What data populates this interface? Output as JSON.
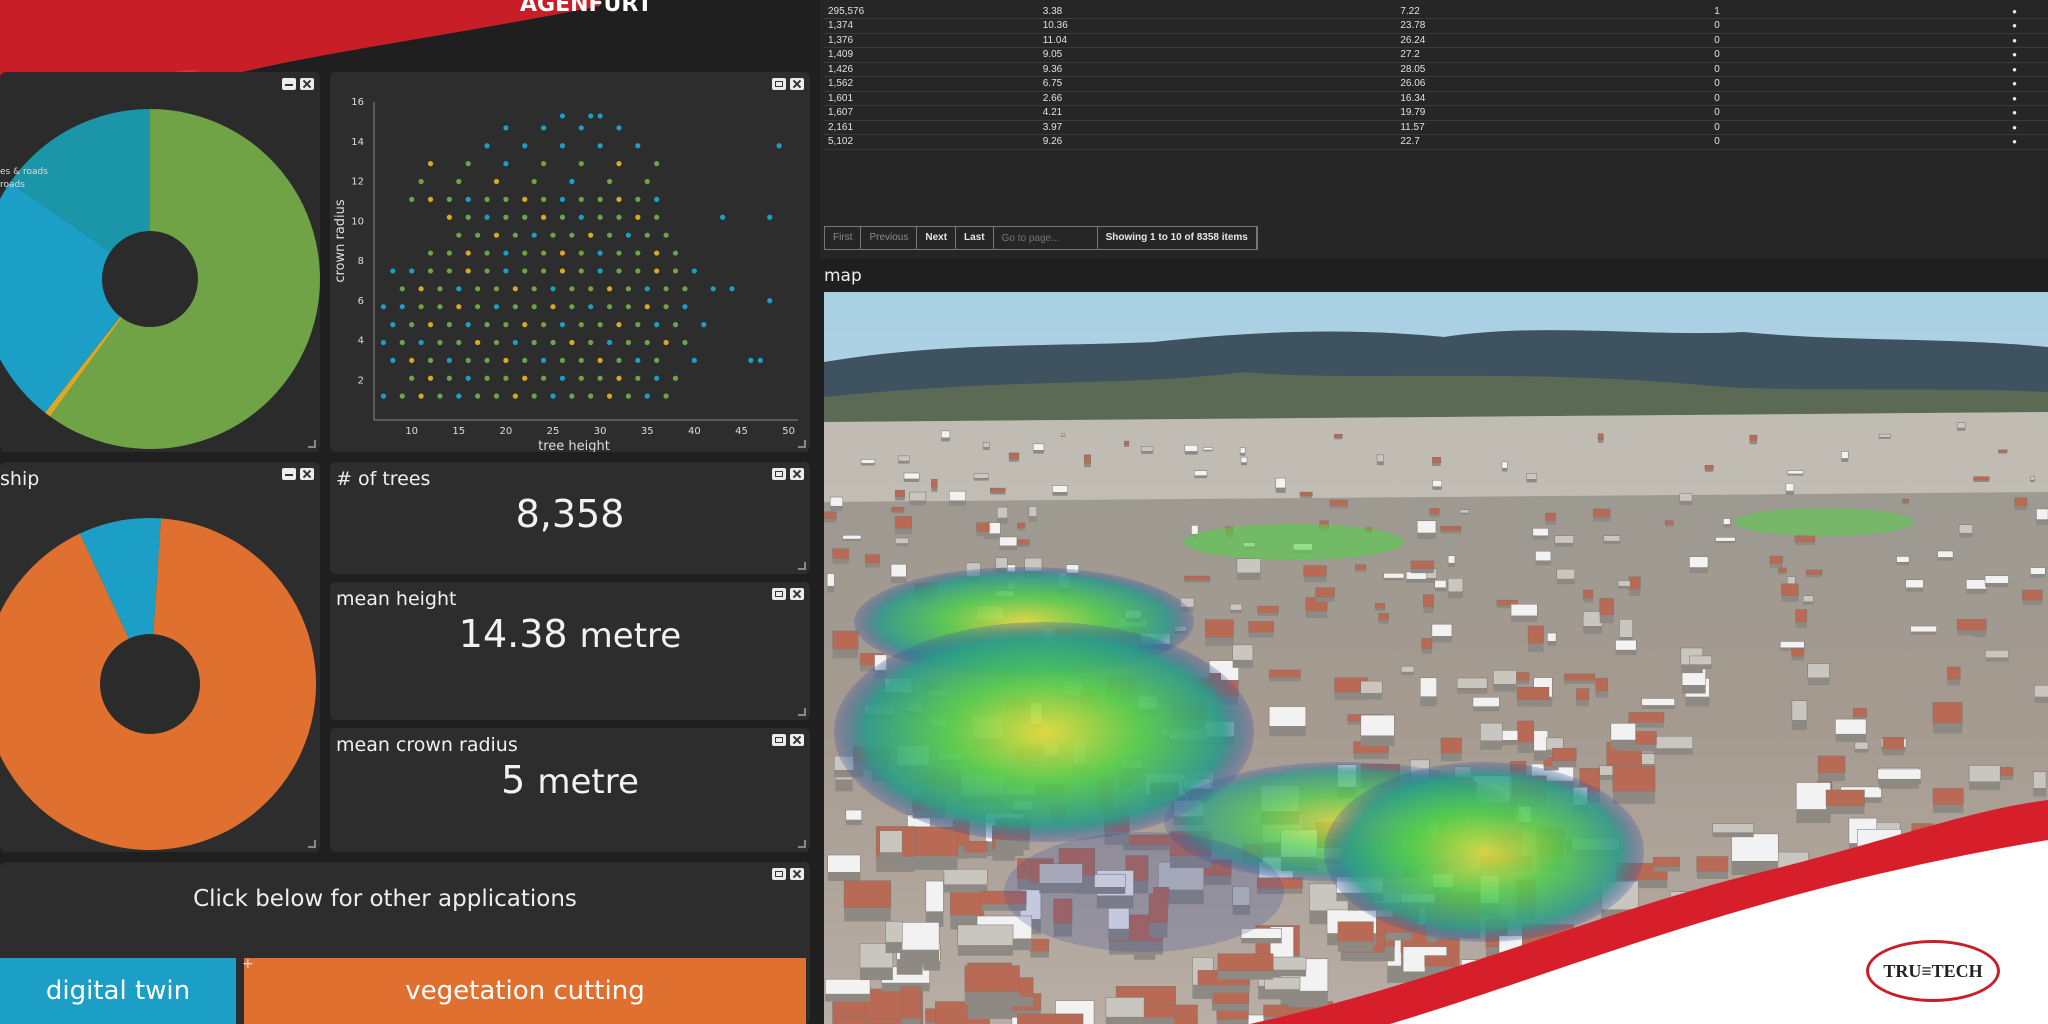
{
  "header": {
    "title": "AGENFURT"
  },
  "colors": {
    "bg": "#1f1f1f",
    "panel": "#2d2d2d",
    "green": "#6fa346",
    "blue": "#1b9fc6",
    "teal": "#1b95a8",
    "orange": "#e07030",
    "yellow": "#d9a826",
    "red": "#d61f2b"
  },
  "scatter": {
    "ylabel": "crown radius",
    "xlabel": "tree height",
    "xticks": [
      "10",
      "15",
      "20",
      "25",
      "30",
      "35",
      "40",
      "45",
      "50"
    ],
    "yticks": [
      "2",
      "4",
      "6",
      "8",
      "10",
      "12",
      "14",
      "16"
    ]
  },
  "pie_top": {
    "legend": [
      "es & roads",
      "roads"
    ]
  },
  "ownership": {
    "title": "ship"
  },
  "trees": {
    "title": "# of trees",
    "value": "8,358"
  },
  "mean_height": {
    "title": "mean height",
    "value": "14.38",
    "unit": "metre"
  },
  "mean_crown": {
    "title": "mean crown radius",
    "value": "5",
    "unit": "metre"
  },
  "apps": {
    "prompt": "Click below for other applications",
    "digital_twin": "digital twin",
    "vegetation": "vegetation cutting"
  },
  "table": {
    "rows": [
      [
        "295,576",
        "3.38",
        "7.22",
        "1"
      ],
      [
        "1,374",
        "10.36",
        "23.78",
        "0"
      ],
      [
        "1,376",
        "11.04",
        "26.24",
        "0"
      ],
      [
        "1,409",
        "9.05",
        "27.2",
        "0"
      ],
      [
        "1,426",
        "9.36",
        "28.05",
        "0"
      ],
      [
        "1,562",
        "6.75",
        "26.06",
        "0"
      ],
      [
        "1,601",
        "2.66",
        "16.34",
        "0"
      ],
      [
        "1,607",
        "4.21",
        "19.79",
        "0"
      ],
      [
        "2,161",
        "3.97",
        "11.57",
        "0"
      ],
      [
        "5,102",
        "9.26",
        "22.7",
        "0"
      ]
    ]
  },
  "pager": {
    "first": "First",
    "previous": "Previous",
    "next": "Next",
    "last": "Last",
    "goto_placeholder": "Go to page...",
    "status": "Showing 1 to 10 of 8358 items"
  },
  "map": {
    "title": "map"
  },
  "logo": {
    "text": "TRU≡TECH"
  },
  "chart_data": [
    {
      "type": "pie",
      "title": "",
      "legend": [
        "es & roads",
        "roads"
      ],
      "slices": [
        {
          "label": "green",
          "value": 60,
          "color": "#6fa346"
        },
        {
          "label": "thin",
          "value": 0.6,
          "color": "#d9a826"
        },
        {
          "label": "blue",
          "value": 24,
          "color": "#1b9fc6"
        },
        {
          "label": "teal",
          "value": 15.4,
          "color": "#1b95a8"
        }
      ]
    },
    {
      "type": "pie",
      "title": "ship",
      "slices": [
        {
          "label": "blue",
          "value": 8,
          "color": "#1b9fc6"
        },
        {
          "label": "orange",
          "value": 92,
          "color": "#e07030"
        }
      ]
    },
    {
      "type": "scatter",
      "xlabel": "tree height",
      "ylabel": "crown radius",
      "xlim": [
        6,
        51
      ],
      "ylim": [
        0,
        16
      ],
      "grid": false,
      "x": [
        7,
        9,
        11,
        13,
        15,
        17,
        19,
        21,
        23,
        25,
        27,
        29,
        31,
        33,
        35,
        37,
        10,
        12,
        14,
        16,
        18,
        20,
        22,
        24,
        26,
        28,
        30,
        32,
        34,
        36,
        38,
        8,
        10,
        12,
        14,
        16,
        18,
        20,
        22,
        24,
        26,
        28,
        30,
        32,
        34,
        36,
        40,
        7,
        9,
        11,
        13,
        15,
        17,
        19,
        21,
        23,
        25,
        27,
        29,
        31,
        33,
        35,
        37,
        39,
        46,
        8,
        10,
        12,
        14,
        16,
        18,
        20,
        22,
        24,
        26,
        28,
        30,
        32,
        34,
        36,
        38,
        41,
        47,
        7,
        9,
        11,
        13,
        15,
        17,
        19,
        21,
        23,
        25,
        27,
        29,
        31,
        33,
        35,
        37,
        39,
        48,
        9,
        11,
        13,
        15,
        17,
        19,
        21,
        23,
        25,
        27,
        29,
        31,
        33,
        35,
        37,
        39,
        42,
        8,
        10,
        12,
        14,
        16,
        18,
        20,
        22,
        24,
        26,
        28,
        30,
        32,
        34,
        36,
        38,
        40,
        12,
        14,
        16,
        18,
        20,
        22,
        24,
        26,
        28,
        30,
        32,
        34,
        36,
        38,
        44,
        15,
        17,
        19,
        21,
        23,
        25,
        27,
        29,
        31,
        33,
        35,
        37,
        14,
        16,
        18,
        20,
        22,
        24,
        26,
        28,
        30,
        32,
        34,
        36,
        43,
        48,
        10,
        12,
        14,
        16,
        18,
        20,
        22,
        24,
        26,
        28,
        30,
        32,
        34,
        36,
        11,
        15,
        19,
        23,
        27,
        31,
        35,
        12,
        16,
        20,
        24,
        28,
        32,
        36,
        18,
        22,
        26,
        30,
        34,
        49,
        20,
        24,
        28,
        32,
        29,
        30,
        26
      ],
      "y": [
        1.2,
        1.2,
        1.2,
        1.2,
        1.2,
        1.2,
        1.2,
        1.2,
        1.2,
        1.2,
        1.2,
        1.2,
        1.2,
        1.2,
        1.2,
        1.2,
        2.1,
        2.1,
        2.1,
        2.1,
        2.1,
        2.1,
        2.1,
        2.1,
        2.1,
        2.1,
        2.1,
        2.1,
        2.1,
        2.1,
        2.1,
        3.0,
        3.0,
        3.0,
        3.0,
        3.0,
        3.0,
        3.0,
        3.0,
        3.0,
        3.0,
        3.0,
        3.0,
        3.0,
        3.0,
        3.0,
        3.0,
        3.9,
        3.9,
        3.9,
        3.9,
        3.9,
        3.9,
        3.9,
        3.9,
        3.9,
        3.9,
        3.9,
        3.9,
        3.9,
        3.9,
        3.9,
        3.9,
        3.9,
        3.0,
        4.8,
        4.8,
        4.8,
        4.8,
        4.8,
        4.8,
        4.8,
        4.8,
        4.8,
        4.8,
        4.8,
        4.8,
        4.8,
        4.8,
        4.8,
        4.8,
        4.8,
        3.0,
        5.7,
        5.7,
        5.7,
        5.7,
        5.7,
        5.7,
        5.7,
        5.7,
        5.7,
        5.7,
        5.7,
        5.7,
        5.7,
        5.7,
        5.7,
        5.7,
        5.7,
        6.0,
        6.6,
        6.6,
        6.6,
        6.6,
        6.6,
        6.6,
        6.6,
        6.6,
        6.6,
        6.6,
        6.6,
        6.6,
        6.6,
        6.6,
        6.6,
        6.6,
        6.6,
        7.5,
        7.5,
        7.5,
        7.5,
        7.5,
        7.5,
        7.5,
        7.5,
        7.5,
        7.5,
        7.5,
        7.5,
        7.5,
        7.5,
        7.5,
        7.5,
        7.5,
        8.4,
        8.4,
        8.4,
        8.4,
        8.4,
        8.4,
        8.4,
        8.4,
        8.4,
        8.4,
        8.4,
        8.4,
        8.4,
        8.4,
        6.6,
        9.3,
        9.3,
        9.3,
        9.3,
        9.3,
        9.3,
        9.3,
        9.3,
        9.3,
        9.3,
        9.3,
        9.3,
        10.2,
        10.2,
        10.2,
        10.2,
        10.2,
        10.2,
        10.2,
        10.2,
        10.2,
        10.2,
        10.2,
        10.2,
        10.2,
        10.2,
        11.1,
        11.1,
        11.1,
        11.1,
        11.1,
        11.1,
        11.1,
        11.1,
        11.1,
        11.1,
        11.1,
        11.1,
        11.1,
        11.1,
        12.0,
        12.0,
        12.0,
        12.0,
        12.0,
        12.0,
        12.0,
        12.9,
        12.9,
        12.9,
        12.9,
        12.9,
        12.9,
        12.9,
        13.8,
        13.8,
        13.8,
        13.8,
        13.8,
        13.8,
        14.7,
        14.7,
        14.7,
        14.7,
        15.3,
        15.3,
        15.3
      ]
    }
  ]
}
